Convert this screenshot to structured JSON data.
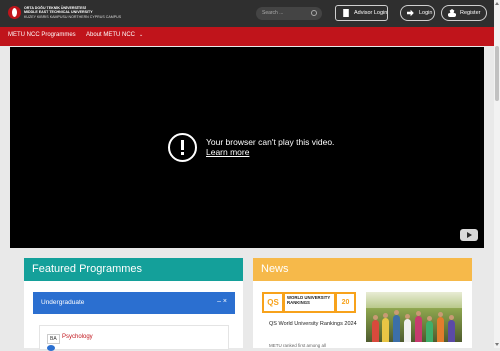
{
  "header": {
    "logo_line1": "ORTA DOĞU TEKNİK ÜNİVERSİTESİ",
    "logo_line2": "MIDDLE EAST TECHNICAL UNIVERSITY",
    "logo_line3": "KUZEY KIBRIS KAMPUSU NORTHERN CYPRUS CAMPUS",
    "search_placeholder": "Search ...",
    "advisor_login": "Advisor Login",
    "login": "Login",
    "register": "Register"
  },
  "nav": {
    "items": [
      {
        "label": "METU NCC Programmes"
      },
      {
        "label": "About METU NCC"
      }
    ]
  },
  "video": {
    "error_title": "Your browser can't play this video.",
    "error_link": "Learn more"
  },
  "featured": {
    "title": "Featured Programmes",
    "panel": "Undergraduate",
    "panel_controls": "– ×",
    "program_badge": "BA",
    "program_name": "Psychology"
  },
  "news": {
    "title": "News",
    "qs_logo": "QS",
    "qs_banner": "WORLD UNIVERSITY RANKINGS",
    "qs_year": "20",
    "item_title": "QS World University Rankings 2024",
    "item_desc": "METU ranked first among all"
  },
  "colors": {
    "topbar": "#2f2f2f",
    "nav": "#c0141b",
    "featured": "#14a09a",
    "news": "#f6b94a",
    "panel": "#2b6fd0"
  }
}
